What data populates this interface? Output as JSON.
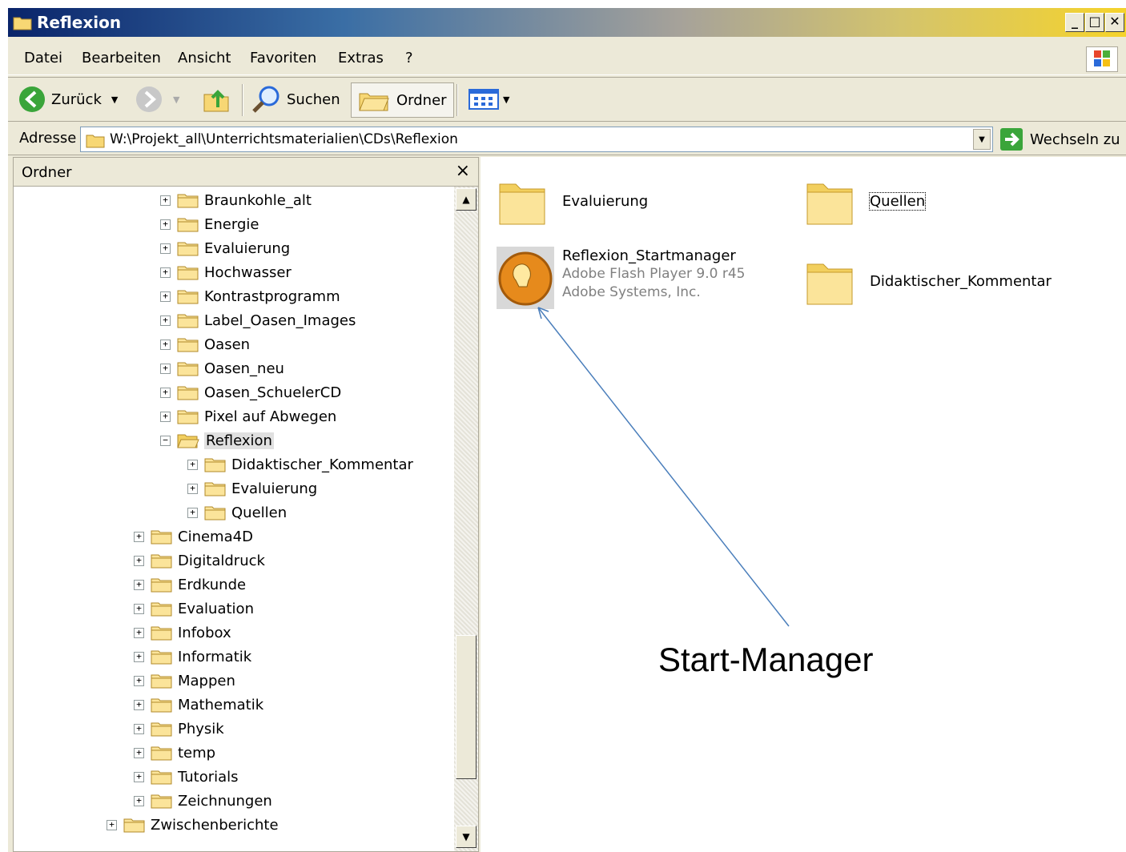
{
  "window": {
    "title": "Reflexion",
    "controls": [
      "_",
      "□",
      "✕"
    ]
  },
  "menubar": {
    "items": [
      "Datei",
      "Bearbeiten",
      "Ansicht",
      "Favoriten",
      "Extras",
      "?"
    ]
  },
  "toolbar": {
    "back_label": "Zurück",
    "search_label": "Suchen",
    "folders_label": "Ordner"
  },
  "address": {
    "label": "Adresse",
    "path": "W:\\Projekt_all\\Unterrichtsmaterialien\\CDs\\Reflexion",
    "go_label": "Wechseln zu"
  },
  "folder_pane": {
    "title": "Ordner",
    "close": "×",
    "tree": [
      {
        "label": "Braunkohle_alt",
        "level": 2,
        "expander": "+"
      },
      {
        "label": "Energie",
        "level": 2,
        "expander": "+"
      },
      {
        "label": "Evaluierung",
        "level": 2,
        "expander": "+"
      },
      {
        "label": "Hochwasser",
        "level": 2,
        "expander": "+"
      },
      {
        "label": "Kontrastprogramm",
        "level": 2,
        "expander": "+"
      },
      {
        "label": "Label_Oasen_Images",
        "level": 2,
        "expander": "+"
      },
      {
        "label": "Oasen",
        "level": 2,
        "expander": "+"
      },
      {
        "label": "Oasen_neu",
        "level": 2,
        "expander": "+"
      },
      {
        "label": "Oasen_SchuelerCD",
        "level": 2,
        "expander": "+"
      },
      {
        "label": "Pixel auf Abwegen",
        "level": 2,
        "expander": "+"
      },
      {
        "label": "Reflexion",
        "level": 2,
        "expander": "−",
        "selected": true,
        "open": true
      },
      {
        "label": "Didaktischer_Kommentar",
        "level": 3,
        "expander": "+"
      },
      {
        "label": "Evaluierung",
        "level": 3,
        "expander": "+"
      },
      {
        "label": "Quellen",
        "level": 3,
        "expander": "+"
      },
      {
        "label": "Cinema4D",
        "level": 1,
        "expander": "+"
      },
      {
        "label": "Digitaldruck",
        "level": 1,
        "expander": "+"
      },
      {
        "label": "Erdkunde",
        "level": 1,
        "expander": "+"
      },
      {
        "label": "Evaluation",
        "level": 1,
        "expander": "+"
      },
      {
        "label": "Infobox",
        "level": 1,
        "expander": "+"
      },
      {
        "label": "Informatik",
        "level": 1,
        "expander": "+"
      },
      {
        "label": "Mappen",
        "level": 1,
        "expander": "+"
      },
      {
        "label": "Mathematik",
        "level": 1,
        "expander": "+"
      },
      {
        "label": "Physik",
        "level": 1,
        "expander": "+"
      },
      {
        "label": "temp",
        "level": 1,
        "expander": "+"
      },
      {
        "label": "Tutorials",
        "level": 1,
        "expander": "+"
      },
      {
        "label": "Zeichnungen",
        "level": 1,
        "expander": "+"
      },
      {
        "label": "Zwischenberichte",
        "level": 0,
        "expander": "+"
      }
    ]
  },
  "content": {
    "items": [
      {
        "name": "Evaluierung",
        "type": "folder"
      },
      {
        "name": "Quellen",
        "type": "folder",
        "focused": true
      },
      {
        "name": "Reflexion_Startmanager",
        "type": "app",
        "sub1": "Adobe Flash Player 9.0  r45",
        "sub2": "Adobe Systems, Inc."
      },
      {
        "name": "Didaktischer_Kommentar",
        "type": "folder"
      }
    ]
  },
  "annotation": {
    "text": "Start-Manager",
    "color": "#4a7ebb"
  },
  "colors": {
    "window_bg": "#ece9d8",
    "folder_yellow": "#f7d774",
    "title_start": "#0a246a",
    "title_end": "#f5d32b"
  }
}
